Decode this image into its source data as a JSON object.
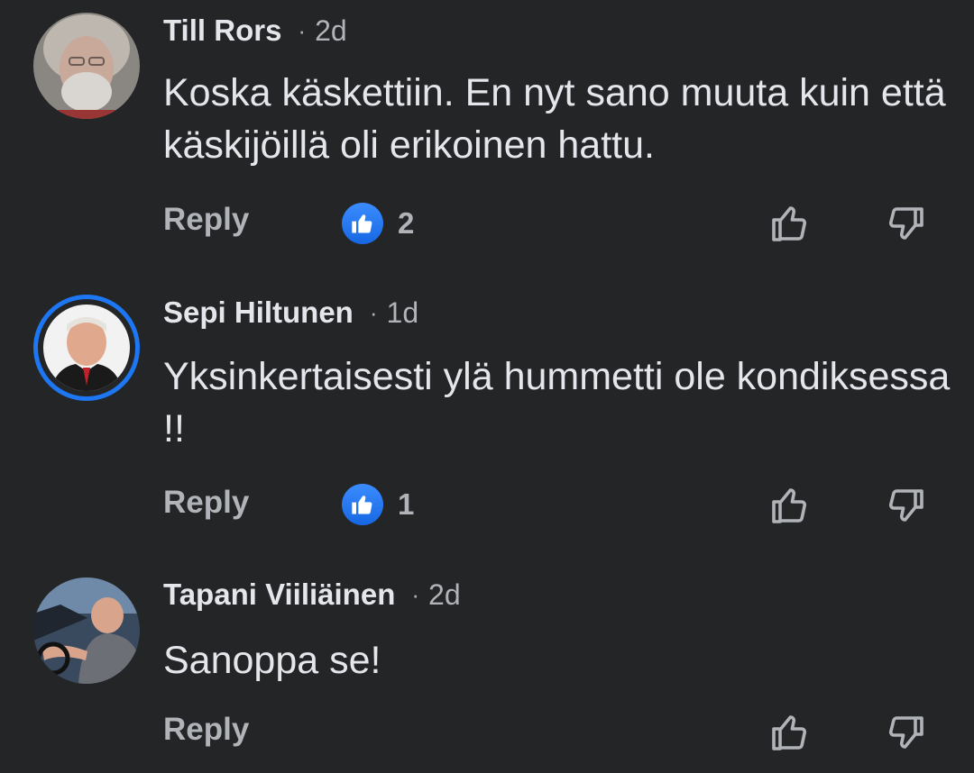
{
  "comments": [
    {
      "author": "Till Rors",
      "separator": "·",
      "time": "2d",
      "text": "Koska käskettiin. En nyt sano muuta kuin että käskijöillä oli erikoinen hattu.",
      "reply_label": "Reply",
      "reaction_icon": "like",
      "reaction_count": "2"
    },
    {
      "author": "Sepi Hiltunen",
      "separator": "·",
      "time": "1d",
      "text": "Yksinkertaisesti ylä hummetti ole kondiksessa !!",
      "reply_label": "Reply",
      "reaction_icon": "like",
      "reaction_count": "1"
    },
    {
      "author": "Tapani Viiliäinen",
      "separator": "·",
      "time": "2d",
      "text": "Sanoppa se!",
      "reply_label": "Reply"
    }
  ],
  "icons": {
    "like_button": "thumbs-up-outline",
    "dislike_button": "thumbs-down-outline",
    "reaction_badge": "like-reaction"
  },
  "colors": {
    "background": "#242526",
    "primary_text": "#e4e6eb",
    "secondary_text": "#b0b3b8",
    "accent": "#1d76f2"
  }
}
